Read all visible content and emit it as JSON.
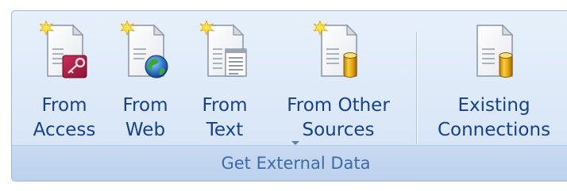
{
  "group": {
    "title": "Get External Data"
  },
  "buttons": {
    "from_access": {
      "line1": "From",
      "line2": "Access",
      "icon": "access-database-document-icon"
    },
    "from_web": {
      "line1": "From",
      "line2": "Web",
      "icon": "web-globe-document-icon"
    },
    "from_text": {
      "line1": "From",
      "line2": "Text",
      "icon": "text-file-document-icon"
    },
    "from_other_sources": {
      "line1": "From Other",
      "line2": "Sources",
      "icon": "other-sources-database-document-icon",
      "has_dropdown": true
    },
    "existing_connections": {
      "line1": "Existing",
      "line2": "Connections",
      "icon": "existing-connections-database-document-icon"
    }
  },
  "colors": {
    "label_text": "#15428b",
    "group_title": "#3e6aaa",
    "ribbon_bg": "#dde9f8",
    "border": "#9fb8d6"
  }
}
